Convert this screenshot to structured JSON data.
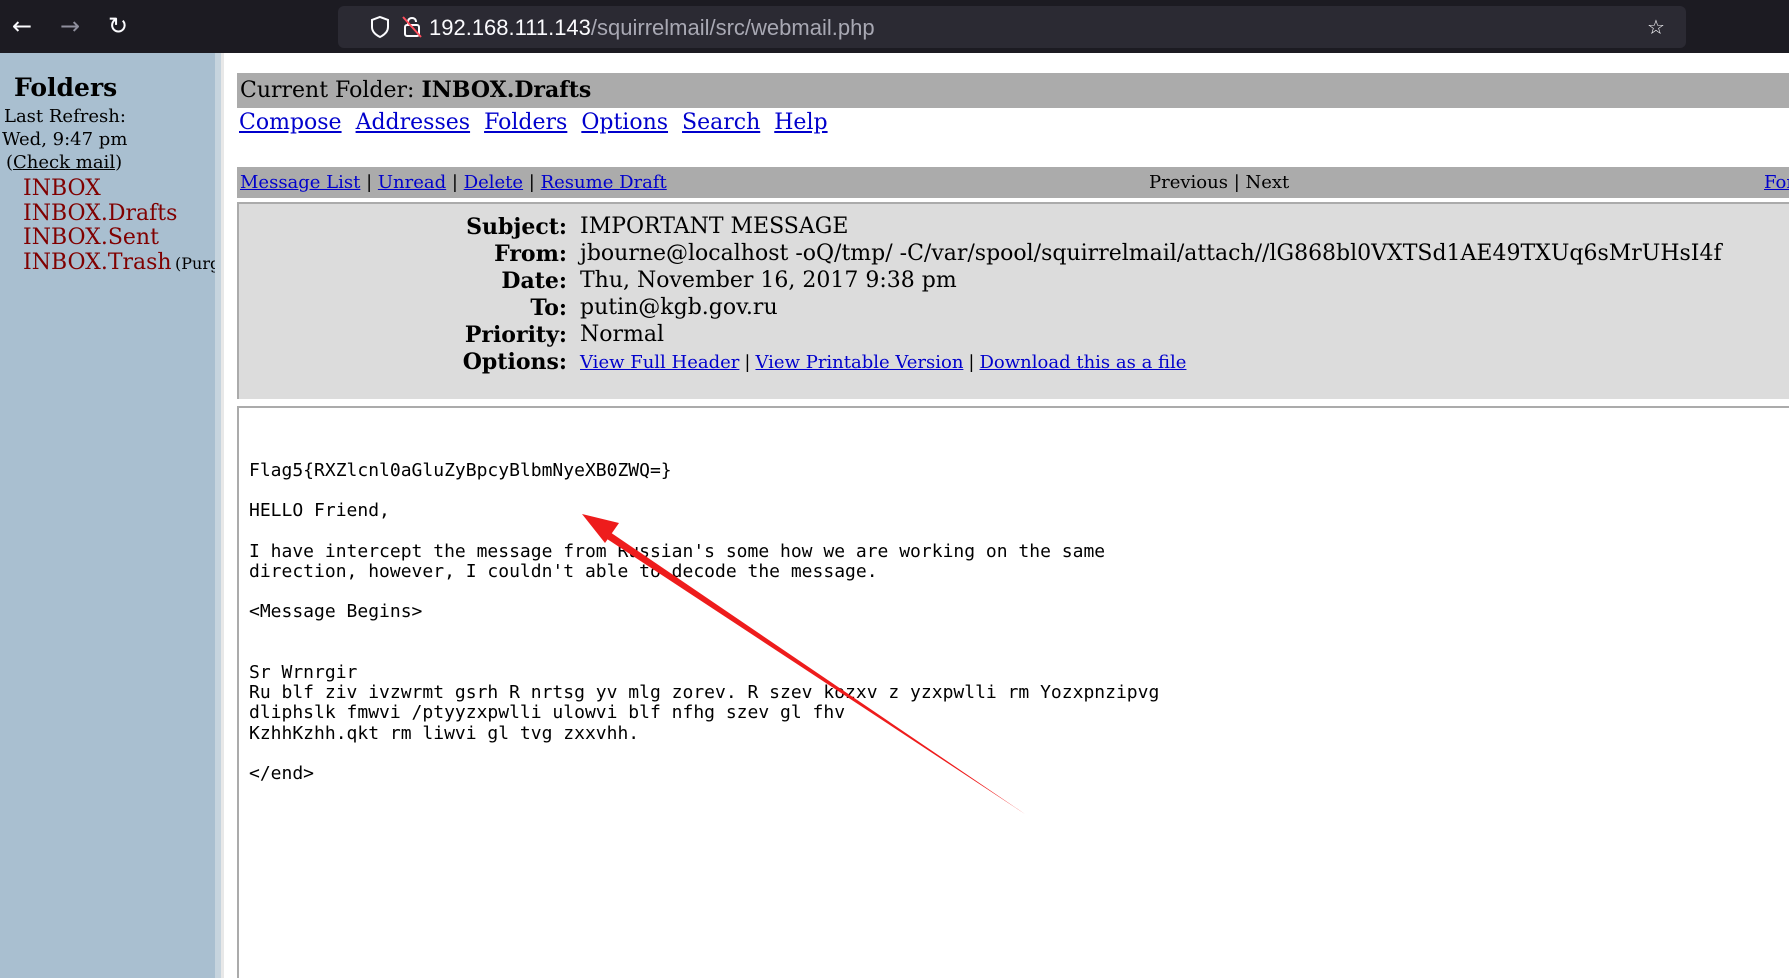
{
  "browser": {
    "url_host": "192.168.111.143",
    "url_path": "/squirrelmail/src/webmail.php"
  },
  "sidebar": {
    "title": "Folders",
    "last_refresh_label": "Last Refresh:",
    "last_refresh_value": "Wed, 9:47 pm",
    "check_mail_open": "(",
    "check_mail": "Check mail",
    "check_mail_close": ")",
    "folders": [
      "INBOX",
      "INBOX.Drafts",
      "INBOX.Sent",
      "INBOX.Trash"
    ],
    "purge_label": "(Purg"
  },
  "main": {
    "current_folder_label": "Current Folder:",
    "current_folder": "INBOX.Drafts",
    "nav": [
      "Compose",
      "Addresses",
      "Folders",
      "Options",
      "Search",
      "Help"
    ],
    "message_actions": [
      "Message List",
      "Unread",
      "Delete",
      "Resume Draft"
    ],
    "previous": "Previous",
    "next": "Next",
    "forward": "Forv"
  },
  "message": {
    "subject_label": "Subject:",
    "subject": "IMPORTANT MESSAGE",
    "from_label": "From:",
    "from": "jbourne@localhost -oQ/tmp/ -C/var/spool/squirrelmail/attach//lG868bl0VXTSd1AE49TXUq6sMrUHsI4f",
    "date_label": "Date:",
    "date": "Thu, November 16, 2017 9:38 pm",
    "to_label": "To:",
    "to": "putin@kgb.gov.ru",
    "priority_label": "Priority:",
    "priority": "Normal",
    "options_label": "Options:",
    "options": [
      "View Full Header",
      "View Printable Version",
      "Download this as a file"
    ],
    "body": "Flag5{RXZlcnl0aGluZyBpcyBlbmNyeXB0ZWQ=}\n\nHELLO Friend,\n\nI have intercept the message from Russian's some how we are working on the same\ndirection, however, I couldn't able to decode the message.\n\n<Message Begins>\n\n\nSr Wrnrgir\nRu blf ziv ivzwrmt gsrh R nrtsg yv mlg zorev. R szev kozxv z yzxpwlli rm Yozxpnzipvg\ndliphslk fmwvi /ptyyzxpwlli ulowvi blf nfhg szev gl fhv\nKzhhKzhh.qkt rm liwvi gl tvg zxxvhh.\n\n</end>"
  },
  "colors": {
    "chrome_bg": "#1c1b22",
    "sidebar_bg": "#a9bfd0",
    "folder_link": "#800000",
    "link": "#0000cc",
    "bar_gray": "#ababab",
    "header_bg": "#dcdcdc",
    "annotation_arrow": "#ee1c1c"
  },
  "icons": [
    "back-arrow-icon",
    "forward-arrow-icon",
    "reload-icon",
    "shield-icon",
    "insecure-lock-icon",
    "bookmark-star-icon"
  ]
}
